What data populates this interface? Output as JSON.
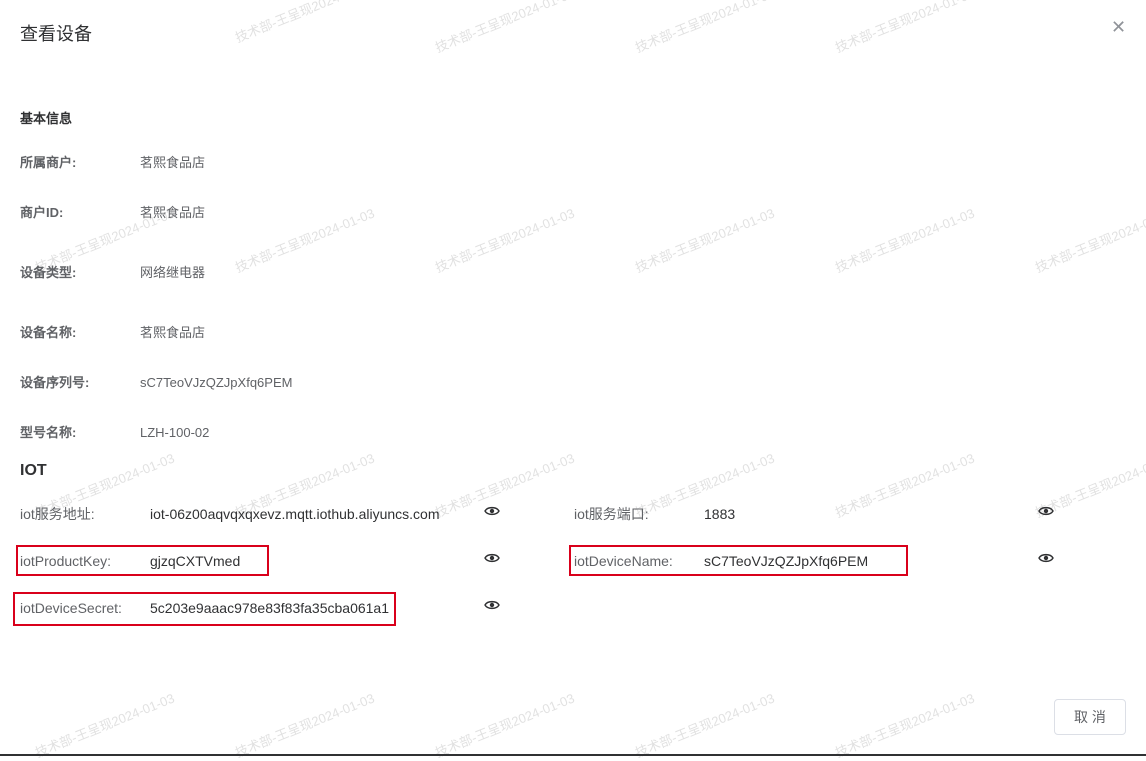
{
  "dialog": {
    "title": "查看设备",
    "close_icon": "close-icon"
  },
  "basic": {
    "title": "基本信息",
    "rows": [
      {
        "label": "所属商户:",
        "value": "茗熙食品店"
      },
      {
        "label": "商户ID:",
        "value": "茗熙食品店"
      },
      {
        "label": "设备类型:",
        "value": "网络继电器"
      },
      {
        "label": "设备名称:",
        "value": "茗熙食品店"
      },
      {
        "label": "设备序列号:",
        "value": "sC7TeoVJzQZJpXfq6PEM"
      },
      {
        "label": "型号名称:",
        "value": "LZH-100-02"
      }
    ]
  },
  "iot": {
    "title": "IOT",
    "fields": [
      {
        "label": "iot服务地址:",
        "value": "iot-06z00aqvqxqxevz.mqtt.iothub.aliyuncs.com"
      },
      {
        "label": "iot服务端口:",
        "value": "1883"
      },
      {
        "label": "iotProductKey:",
        "value": "gjzqCXTVmed"
      },
      {
        "label": "iotDeviceName:",
        "value": "sC7TeoVJzQZJpXfq6PEM"
      },
      {
        "label": "iotDeviceSecret:",
        "value": "5c203e9aaac978e83f83fa35cba061a1"
      }
    ],
    "highlight_color": "#d9001b"
  },
  "footer": {
    "cancel_label": "取 消"
  },
  "watermark": {
    "text": "技术部-王呈现2024-01-03"
  }
}
